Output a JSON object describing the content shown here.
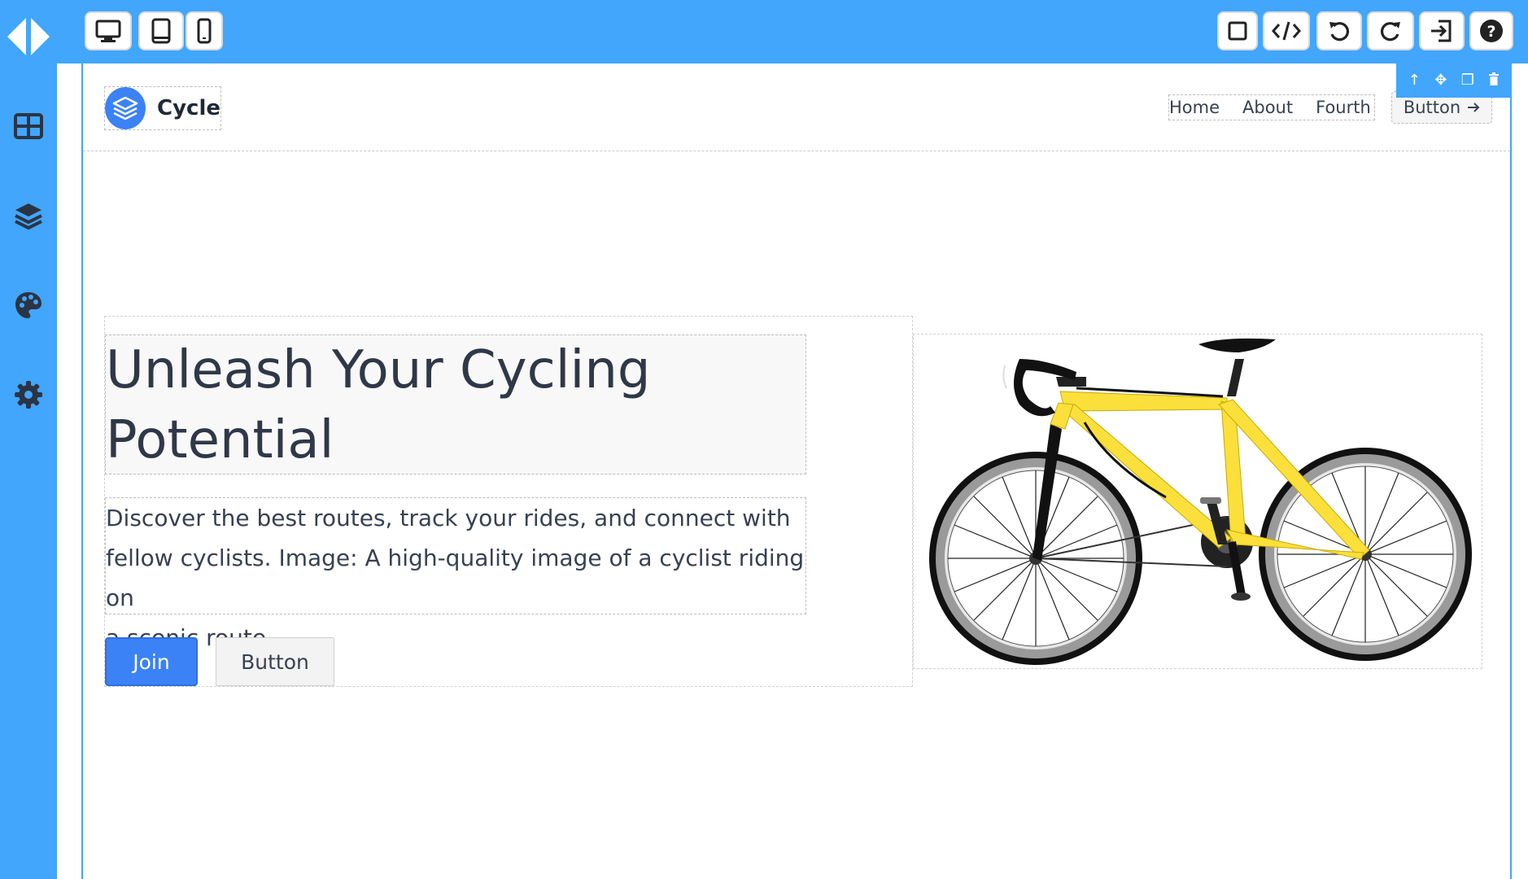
{
  "editor": {
    "toolbar_icons": [
      "desktop-icon",
      "tablet-icon",
      "mobile-icon",
      "square-icon",
      "code-icon",
      "undo-icon",
      "redo-icon",
      "export-icon",
      "help-icon"
    ],
    "sidebar_icons": [
      "blocks-icon",
      "layers-icon",
      "palette-icon",
      "settings-icon"
    ],
    "accent_color": "#41a6fc",
    "selection_toolbar_icons": [
      "arrow-up-icon",
      "move-icon",
      "copy-icon",
      "trash-icon"
    ]
  },
  "site": {
    "brand_name": "Cycle",
    "nav": {
      "links": [
        "Home",
        "About",
        "Fourth"
      ],
      "button_label": "Button",
      "button_icon": "arrow-right-icon"
    },
    "hero": {
      "heading_line1": "Unleash Your Cycling",
      "heading_line2": "Potential",
      "paragraph_line1": "Discover the best routes, track your rides, and connect with",
      "paragraph_line2": "fellow cyclists. Image: A high-quality image of a cyclist riding on",
      "paragraph_line3": "a scenic route.",
      "primary_button": "Join",
      "secondary_button": "Button",
      "primary_color": "#3b82f6"
    }
  }
}
